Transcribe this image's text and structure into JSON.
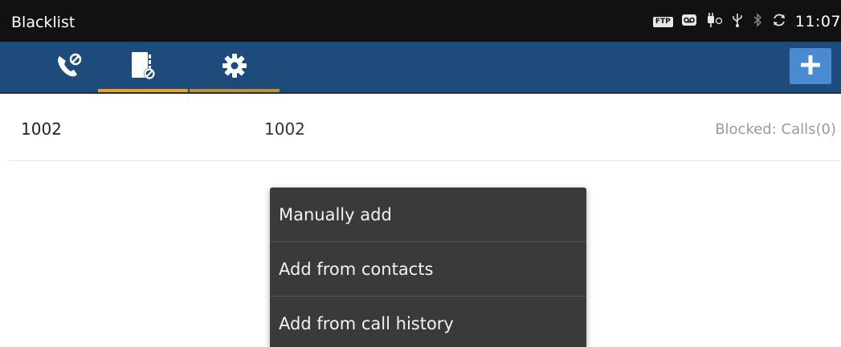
{
  "status_bar": {
    "title": "Blacklist",
    "ftp_badge": "FTP",
    "time": "11:07",
    "icons": [
      "ftp-icon",
      "voicemail-icon",
      "usb-debug-icon",
      "usb-icon",
      "bluetooth-icon",
      "sync-icon"
    ]
  },
  "tabs": [
    {
      "name": "tab-calls",
      "icon": "blocked-call-icon",
      "active": false
    },
    {
      "name": "tab-blacklist",
      "icon": "blocked-contacts-icon",
      "active": true
    },
    {
      "name": "tab-settings",
      "icon": "gear-icon",
      "active": false
    }
  ],
  "add_button": {
    "icon": "plus-icon"
  },
  "blacklist": [
    {
      "name": "1002",
      "number": "1002",
      "status": "Blocked: Calls(0)"
    }
  ],
  "popup_menu": {
    "items": [
      "Manually add",
      "Add from contacts",
      "Add from call history"
    ]
  },
  "colors": {
    "status_bar": "#111111",
    "tab_bar": "#1d4b7b",
    "tab_indicator": "#f0a020",
    "add_button": "#4a8ad0",
    "menu_bg": "#3a3a3a"
  }
}
